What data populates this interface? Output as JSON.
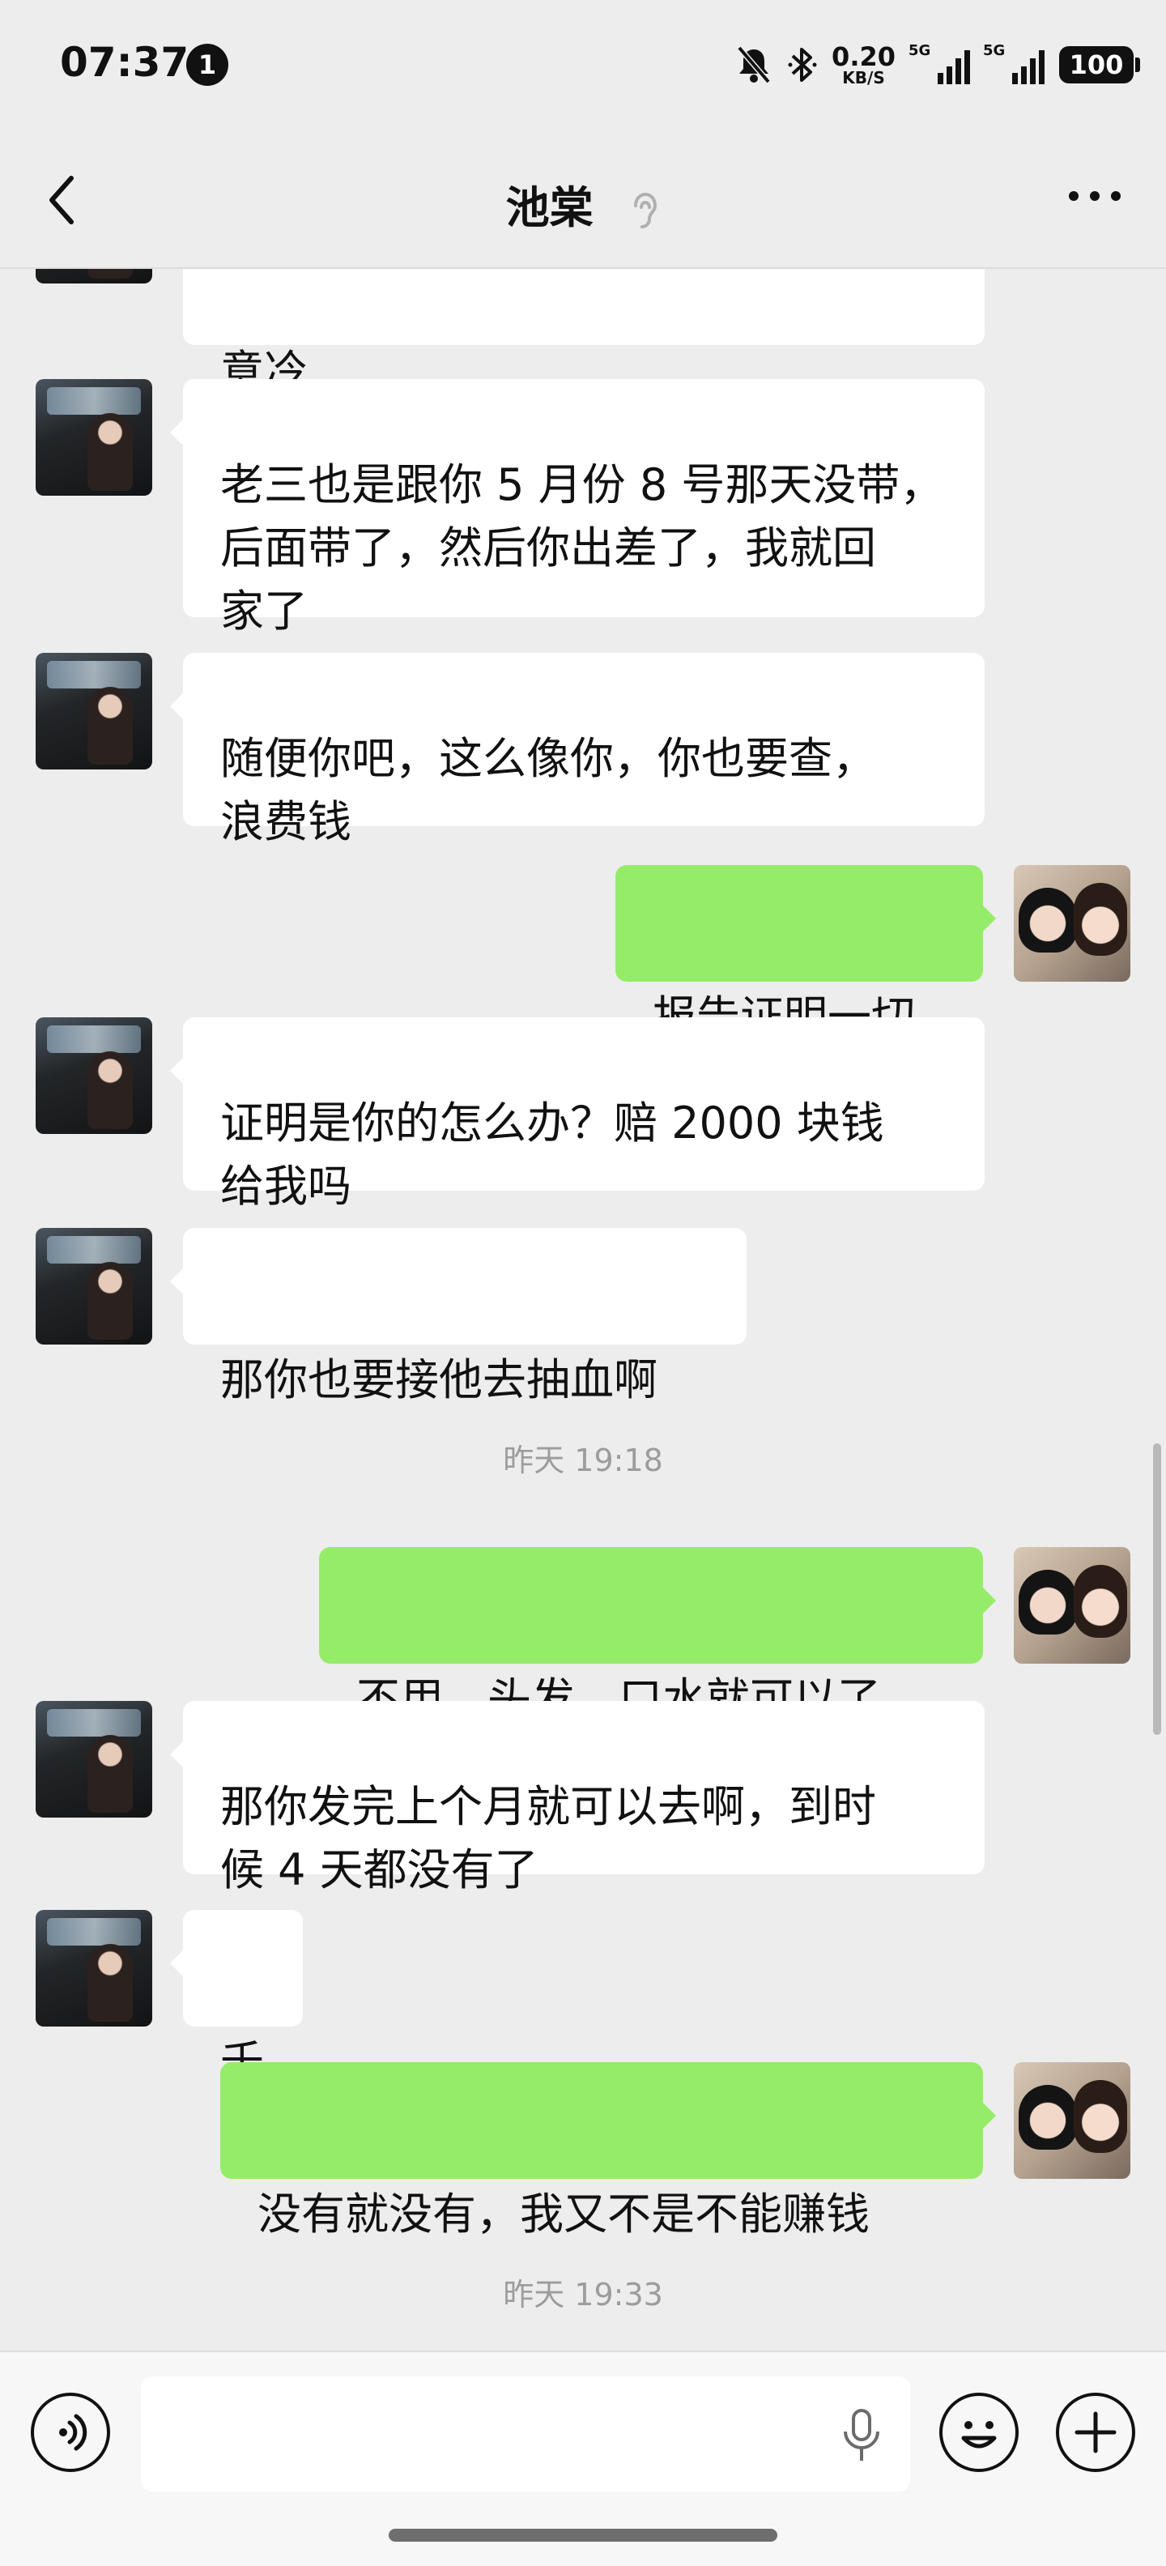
{
  "status_bar": {
    "time": "07:37",
    "notification_count": "1",
    "net_speed_value": "0.20",
    "net_speed_unit": "KB/S",
    "signal1_label": "5G",
    "signal2_label": "5G",
    "battery": "100"
  },
  "nav": {
    "title": "池棠",
    "back_icon": "chevron-left-icon",
    "ear_icon": "ear-icon",
    "more_icon": "more-dots-icon"
  },
  "messages": [
    {
      "side": "left",
      "text": "意冷"
    },
    {
      "side": "left",
      "text": "老三也是跟你 5 月份 8 号那天没带，\n后面带了，然后你出差了，我就回\n家了"
    },
    {
      "side": "left",
      "text": "随便你吧，这么像你，你也要查，\n浪费钱"
    },
    {
      "side": "right",
      "text": "报告证明一切"
    },
    {
      "side": "left",
      "text": "证明是你的怎么办？赔 2000 块钱\n给我吗"
    },
    {
      "side": "left",
      "text": "那你也要接他去抽血啊"
    },
    {
      "side": "right",
      "text": "不用，头发，口水就可以了"
    },
    {
      "side": "left",
      "text": "那你发完上个月就可以去啊，到时\n候 4 天都没有了"
    },
    {
      "side": "left",
      "text": "千"
    },
    {
      "side": "right",
      "text": "没有就没有，我又不是不能赚钱"
    }
  ],
  "timestamps": [
    "昨天 19:18",
    "昨天 19:33"
  ],
  "input_bar": {
    "voice_icon": "voice-toggle-icon",
    "mic_icon": "microphone-icon",
    "emoji_icon": "emoji-icon",
    "plus_icon": "plus-icon"
  },
  "colors": {
    "background": "#ededed",
    "bubble_left": "#ffffff",
    "bubble_right": "#95ec69",
    "timestamp": "#9c9c9c"
  }
}
